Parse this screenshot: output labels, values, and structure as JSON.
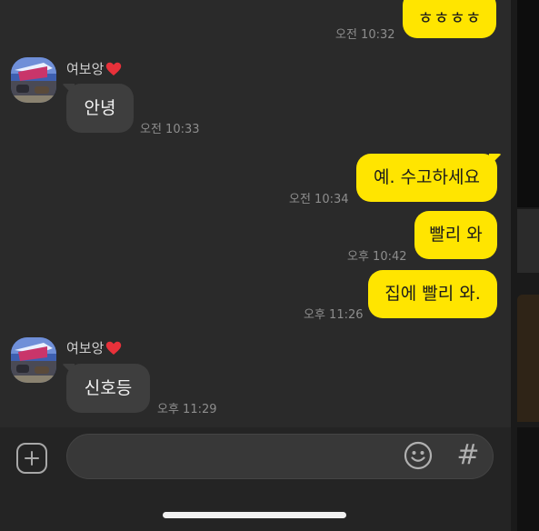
{
  "messages": [
    {
      "from": "me",
      "text": "ㅎㅎㅎㅎ",
      "time": "오전 10:32"
    },
    {
      "from": "them",
      "sender": "여보앙",
      "text": "안녕",
      "time": "오전 10:33"
    },
    {
      "from": "me",
      "text": "예. 수고하세요",
      "time": "오전 10:34"
    },
    {
      "from": "me",
      "text": "빨리 와",
      "time": "오후 10:42"
    },
    {
      "from": "me",
      "text": "집에 빨리 와.",
      "time": "오후 11:26"
    },
    {
      "from": "them",
      "sender": "여보앙",
      "text": "신호등",
      "time": "오후 11:29"
    }
  ],
  "input": {
    "value": "",
    "hash_label": "#"
  },
  "icons": {
    "add": "plus-square-icon",
    "emoji": "smiley-icon",
    "hash": "hash-icon",
    "heart": "heart-icon"
  },
  "colors": {
    "my_bubble": "#ffe500",
    "their_bubble": "#3e3e3e",
    "background": "#2a2a2a",
    "heart": "#e8313a"
  }
}
